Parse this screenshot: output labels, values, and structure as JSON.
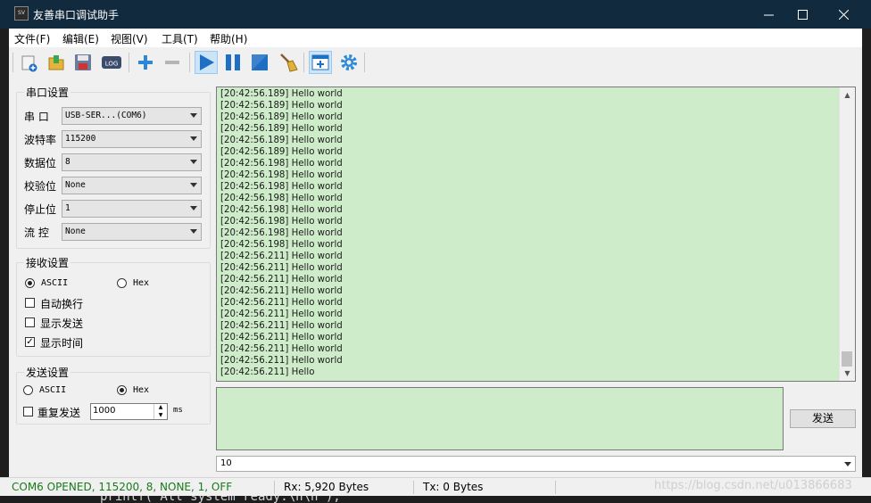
{
  "window": {
    "title": "友善串口调试助手",
    "icon_text": "SV"
  },
  "menu": [
    "文件(F)",
    "编辑(E)",
    "视图(V)",
    "工具(T)",
    "帮助(H)"
  ],
  "toolbar_icons": [
    "new-file-icon",
    "open-folder-icon",
    "save-icon",
    "log-icon",
    "add-icon",
    "remove-icon",
    "play-icon",
    "pause-icon",
    "stop-icon",
    "broom-icon",
    "window-add-icon",
    "gear-icon"
  ],
  "toolbar_log_label": "LOG",
  "serial_settings": {
    "title": "串口设置",
    "fields": [
      {
        "label": "串  口",
        "value": "USB-SER...(COM6)"
      },
      {
        "label": "波特率",
        "value": "115200"
      },
      {
        "label": "数据位",
        "value": "8"
      },
      {
        "label": "校验位",
        "value": "None"
      },
      {
        "label": "停止位",
        "value": "1"
      },
      {
        "label": "流  控",
        "value": "None"
      }
    ]
  },
  "receive_settings": {
    "title": "接收设置",
    "ascii_label": "ASCII",
    "hex_label": "Hex",
    "selected": "ASCII",
    "auto_wrap_label": "自动换行",
    "auto_wrap": false,
    "show_send_label": "显示发送",
    "show_send": false,
    "show_time_label": "显示时间",
    "show_time": true
  },
  "send_settings": {
    "title": "发送设置",
    "ascii_label": "ASCII",
    "hex_label": "Hex",
    "selected": "Hex",
    "repeat_label": "重复发送",
    "repeat": false,
    "interval": "1000",
    "interval_unit": "ms"
  },
  "receive_log": [
    "[20:42:56.189] Hello world",
    "[20:42:56.189] Hello world",
    "[20:42:56.189] Hello world",
    "[20:42:56.189] Hello world",
    "[20:42:56.189] Hello world",
    "[20:42:56.189] Hello world",
    "[20:42:56.198] Hello world",
    "[20:42:56.198] Hello world",
    "[20:42:56.198] Hello world",
    "[20:42:56.198] Hello world",
    "[20:42:56.198] Hello world",
    "[20:42:56.198] Hello world",
    "[20:42:56.198] Hello world",
    "[20:42:56.198] Hello world",
    "[20:42:56.211] Hello world",
    "[20:42:56.211] Hello world",
    "[20:42:56.211] Hello world",
    "[20:42:56.211] Hello world",
    "[20:42:56.211] Hello world",
    "[20:42:56.211] Hello world",
    "[20:42:56.211] Hello world",
    "[20:42:56.211] Hello world",
    "[20:42:56.211] Hello world",
    "[20:42:56.211] Hello world",
    "[20:42:56.211] Hello"
  ],
  "send_button_label": "发送",
  "history_value": "10",
  "status": {
    "connection": "COM6 OPENED, 115200, 8, NONE, 1, OFF",
    "rx": "Rx: 5,920 Bytes",
    "tx": "Tx: 0 Bytes"
  },
  "colors": {
    "title_bar": "#122a3d",
    "log_background": "#ceecc9",
    "status_ok": "#1a7a1a"
  },
  "background_code": "printf( All system ready.\\n\\n );",
  "watermark": "https://blog.csdn.net/u013866683"
}
